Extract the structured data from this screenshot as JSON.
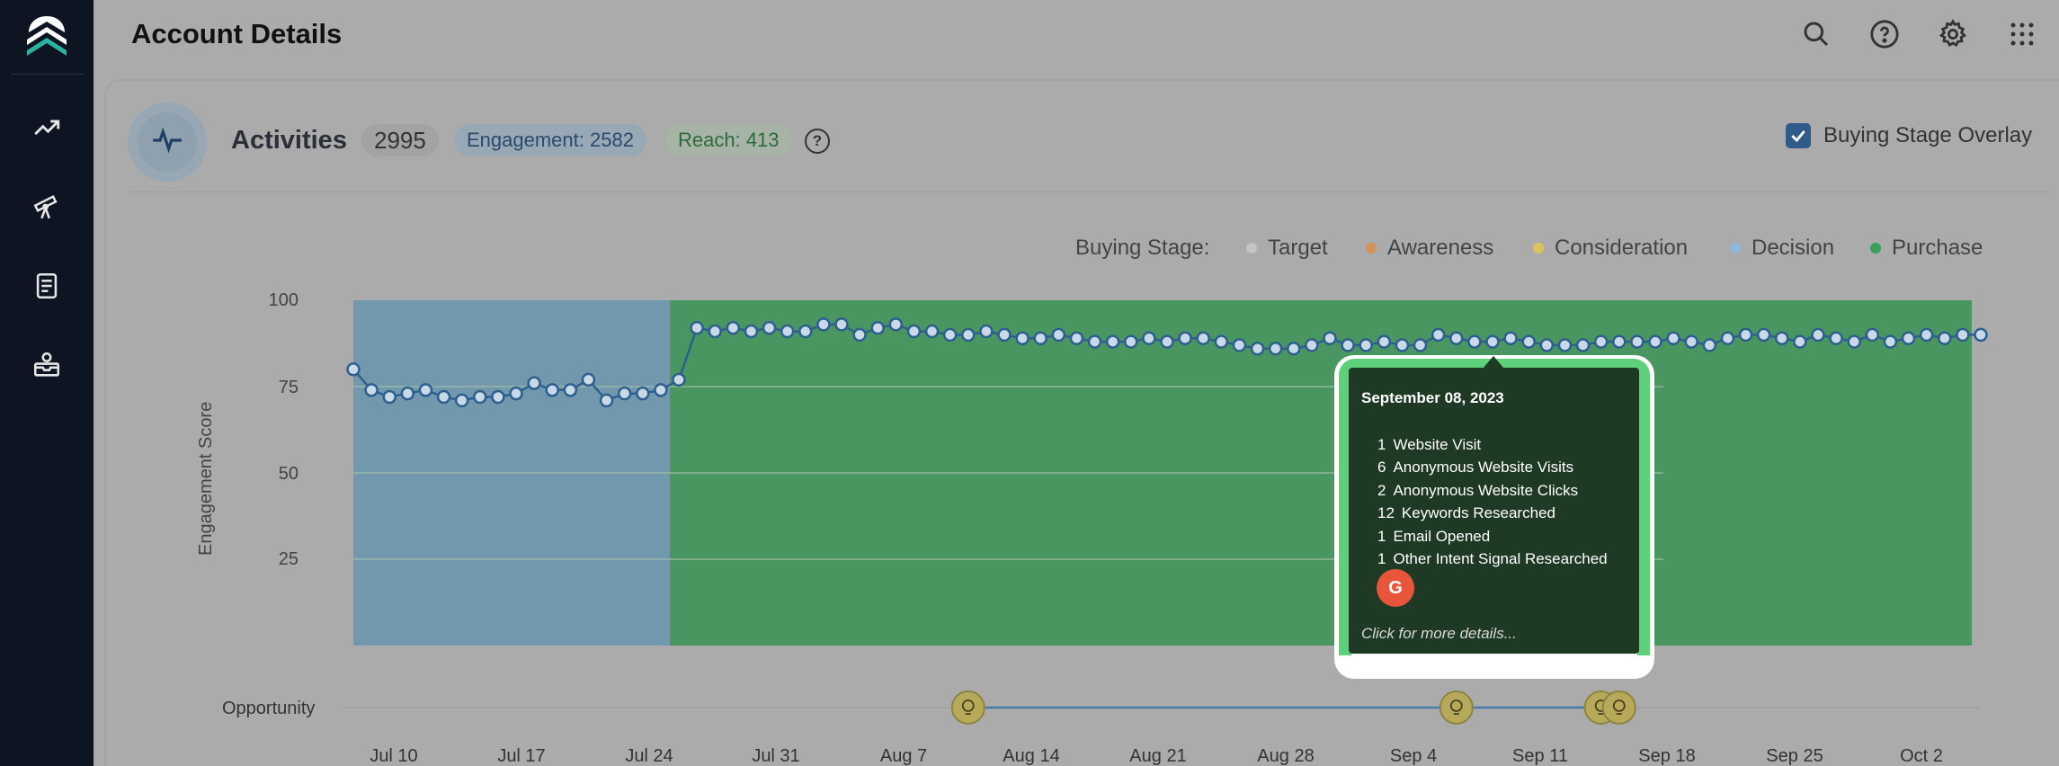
{
  "header": {
    "title": "Account Details"
  },
  "sidebar": {
    "items": [
      {
        "icon": "trending-up-icon"
      },
      {
        "icon": "telescope-icon"
      },
      {
        "icon": "document-icon"
      },
      {
        "icon": "inbox-icon"
      }
    ]
  },
  "activities": {
    "title": "Activities",
    "total": "2995",
    "engagement": "Engagement: 2582",
    "reach": "Reach: 413",
    "overlay_label": "Buying Stage Overlay",
    "overlay_checked": true
  },
  "legend": {
    "label": "Buying Stage:",
    "items": [
      {
        "name": "Target",
        "color": "#c4c4c4"
      },
      {
        "name": "Awareness",
        "color": "#d4915a"
      },
      {
        "name": "Consideration",
        "color": "#d9c45a"
      },
      {
        "name": "Decision",
        "color": "#8fb8d6"
      },
      {
        "name": "Purchase",
        "color": "#3aa05a"
      }
    ]
  },
  "tooltip": {
    "date": "September 08, 2023",
    "rows": [
      {
        "n": "1",
        "label": "Website Visit"
      },
      {
        "n": "6",
        "label": "Anonymous Website Visits"
      },
      {
        "n": "2",
        "label": "Anonymous Website Clicks"
      },
      {
        "n": "12",
        "label": "Keywords Researched"
      },
      {
        "n": "1",
        "label": "Email Opened"
      },
      {
        "n": "1",
        "label": "Other Intent Signal Researched"
      }
    ],
    "badge": "G",
    "more": "Click for more details..."
  },
  "opportunity_label": "Opportunity",
  "chart_data": {
    "type": "line",
    "ylabel": "Engagement Score",
    "yticks": [
      "100",
      "75",
      "50",
      "25"
    ],
    "ylim": [
      0,
      100
    ],
    "xticks": [
      "Jul 10",
      "Jul 17",
      "Jul 24",
      "Jul 31",
      "Aug 7",
      "Aug 14",
      "Aug 21",
      "Aug 28",
      "Sep 4",
      "Sep 11",
      "Sep 18",
      "Sep 25",
      "Oct 2"
    ],
    "stages": [
      {
        "stage": "Decision",
        "from": 0,
        "to": 18,
        "color": "#7298ad"
      },
      {
        "stage": "Purchase",
        "from": 18,
        "to": 90,
        "color": "#4a9660"
      }
    ],
    "series": [
      {
        "values": [
          80,
          74,
          72,
          73,
          74,
          72,
          71,
          72,
          72,
          73,
          76,
          74,
          74,
          77,
          71,
          73,
          73,
          74,
          77,
          92,
          91,
          92,
          91,
          92,
          91,
          91,
          93,
          93,
          90,
          92,
          93,
          91,
          91,
          90,
          90,
          91,
          90,
          89,
          89,
          90,
          89,
          88,
          88,
          88,
          89,
          88,
          89,
          89,
          88,
          87,
          86,
          86,
          86,
          87,
          89,
          87,
          87,
          88,
          87,
          87,
          90,
          89,
          88,
          88,
          89,
          88,
          87,
          87,
          87,
          88,
          88,
          88,
          88,
          89,
          88,
          87,
          89,
          90,
          90,
          89,
          88,
          90,
          89,
          88,
          90,
          88,
          89,
          90,
          89,
          90,
          90
        ]
      }
    ],
    "opportunities": [
      {
        "index": 34
      },
      {
        "index": 61
      },
      {
        "index": 69
      },
      {
        "index": 70
      }
    ]
  }
}
